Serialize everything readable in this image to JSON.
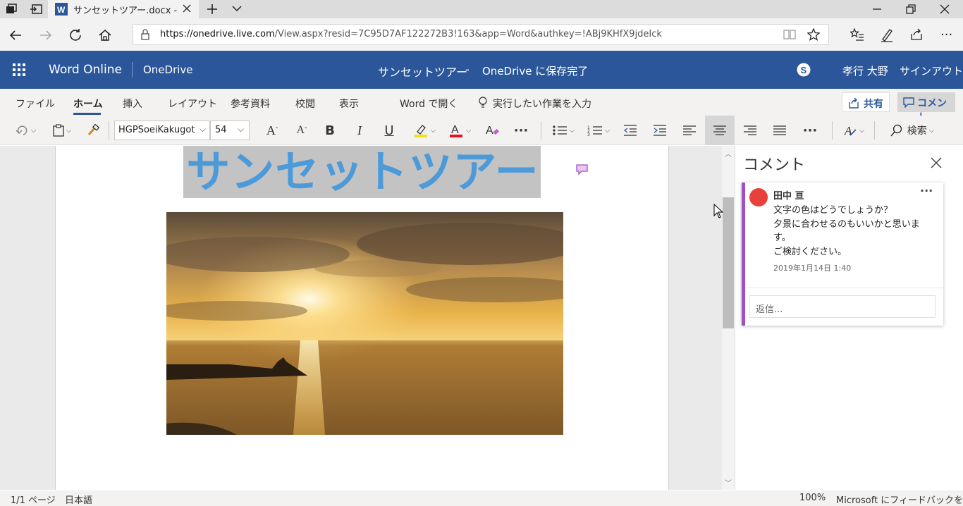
{
  "browser": {
    "tab_title": "サンセットツアー.docx - Mi",
    "url_host": "https://onedrive.live.com",
    "url_rest": "/View.aspx?resid=7C95D7AF122272B3!163&app=Word&authkey=!ABj9KHfX9jdeIck"
  },
  "header": {
    "app_name": "Word Online",
    "onedrive": "OneDrive",
    "doc_name": "サンセットツアー",
    "dash": "-",
    "save_status": "OneDrive に保存完了",
    "user_name": "孝行 大野",
    "signout": "サインアウト"
  },
  "ribbon": {
    "tabs": [
      "ファイル",
      "ホーム",
      "挿入",
      "レイアウト",
      "参考資料",
      "校閲",
      "表示",
      "Word で開く"
    ],
    "active_tab": "ホーム",
    "tell_me": "実行したい作業を入力",
    "share": "共有",
    "comment": "コメント",
    "font_name": "HGPSoeiKakugot",
    "font_size": "54",
    "search": "検索"
  },
  "document": {
    "title": "サンセットツアー",
    "image_alt": "sunset photo"
  },
  "comments": {
    "pane_title": "コメント",
    "author": "田中 亘",
    "body_lines": [
      "文字の色はどうでしょうか？",
      "夕景に合わせるのもいいかと思いま",
      "す。",
      "ご検討ください。"
    ],
    "date": "2019年1月14日 1:40",
    "reply_placeholder": "返信..."
  },
  "status": {
    "page": "1/1 ページ",
    "language": "日本語",
    "zoom": "100%",
    "feedback": "Microsoft にフィードバックを送信"
  },
  "colors": {
    "word_blue": "#2b579a",
    "title_text": "#4d9ad9",
    "comment_accent": "#a050c4",
    "avatar": "#e8413c"
  }
}
